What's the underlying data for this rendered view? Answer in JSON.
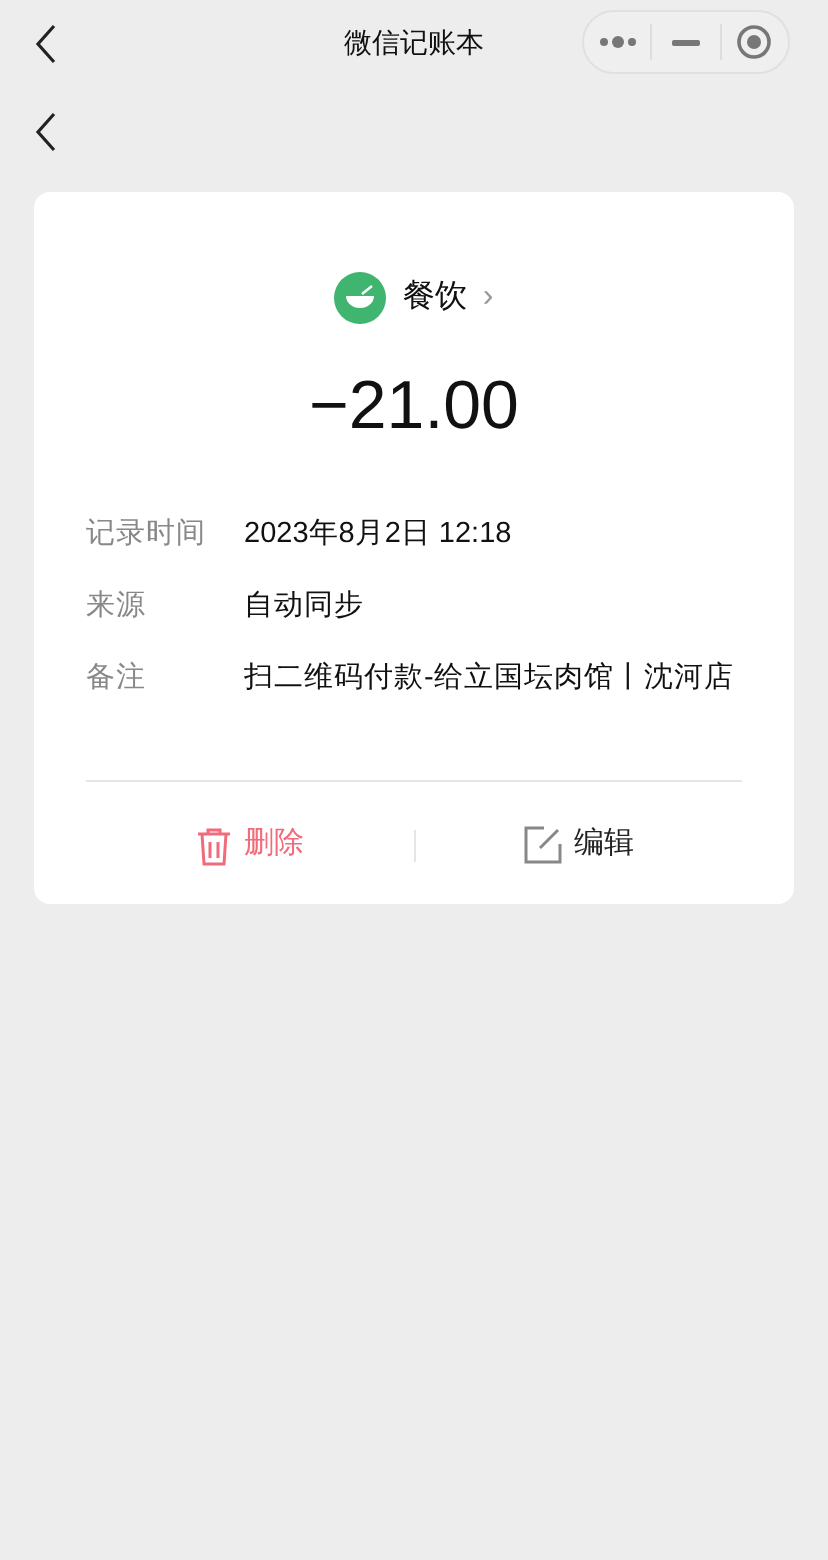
{
  "nav_bar": {
    "title": "微信记账本"
  },
  "category": {
    "name": "餐饮",
    "chevron": "›"
  },
  "amount": "−21.00",
  "details": [
    {
      "label": "记录时间",
      "value": "2023年8月2日 12:18"
    },
    {
      "label": "来源",
      "value": "自动同步"
    },
    {
      "label": "备注",
      "value": "扫二维码付款-给立国坛肉馆丨沈河店"
    }
  ],
  "actions": [
    {
      "kind": "delete",
      "label": "删除"
    },
    {
      "kind": "edit",
      "label": "编辑"
    }
  ]
}
